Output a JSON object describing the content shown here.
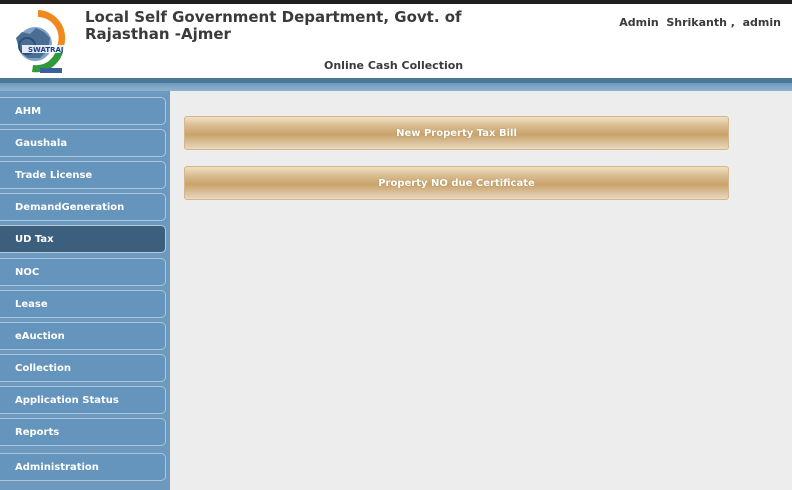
{
  "header": {
    "department_line1": "Local Self Government Department, Govt. of",
    "department_line2": "Rajasthan -Ajmer",
    "user_info": "Admin  Shrikanth ,  admin",
    "app_title": "Online Cash Collection",
    "logo_text": "SWATRAJ"
  },
  "sidebar": {
    "items": [
      {
        "label": "AHM"
      },
      {
        "label": "Gaushala"
      },
      {
        "label": "Trade License"
      },
      {
        "label": "DemandGeneration"
      },
      {
        "label": "UD Tax",
        "active": true
      },
      {
        "label": "NOC"
      },
      {
        "label": "Lease"
      },
      {
        "label": "eAuction"
      },
      {
        "label": "Collection"
      },
      {
        "label": "Application Status"
      },
      {
        "label": "Reports"
      },
      {
        "label": "Administration"
      }
    ]
  },
  "main": {
    "buttons": [
      {
        "label": "New Property Tax Bill"
      },
      {
        "label": "Property NO due Certificate"
      }
    ]
  },
  "colors": {
    "sidebar_bg": "#6e99bf",
    "active_item": "#3d5f7e",
    "accent_bar": "#4b7899"
  }
}
